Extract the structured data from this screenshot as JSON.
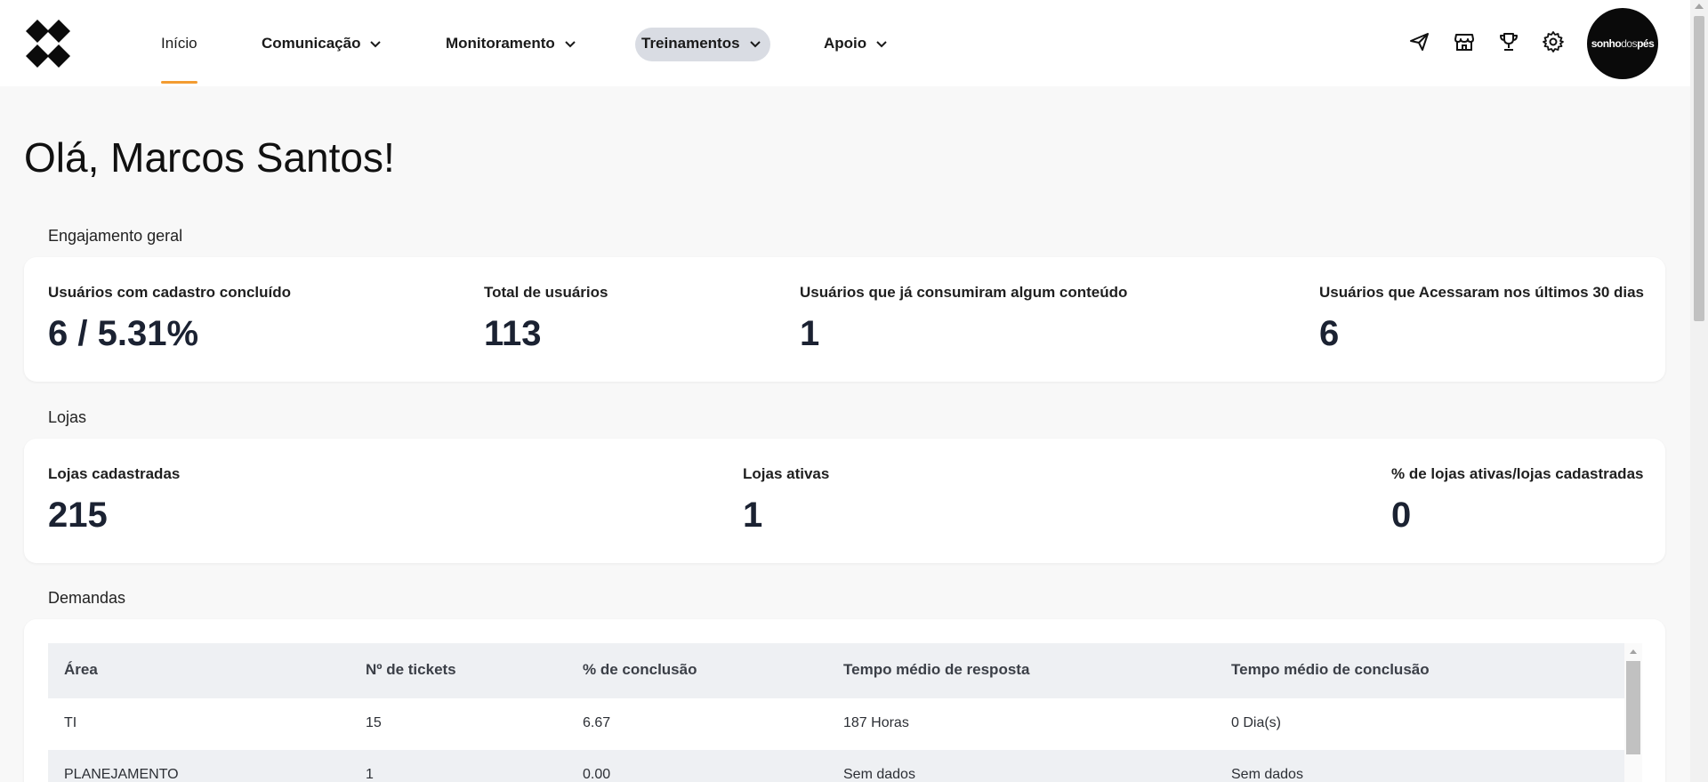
{
  "header": {
    "logo_icon": "diamond-grid-logo",
    "nav": [
      {
        "label": "Início",
        "has_dropdown": false,
        "active": true
      },
      {
        "label": "Comunicação",
        "has_dropdown": true
      },
      {
        "label": "Monitoramento",
        "has_dropdown": true
      },
      {
        "label": "Treinamentos",
        "has_dropdown": true,
        "highlighted": true
      },
      {
        "label": "Apoio",
        "has_dropdown": true
      }
    ],
    "icons": [
      "send-icon",
      "store-icon",
      "trophy-icon",
      "gear-icon"
    ],
    "brand": {
      "part1": "sonho",
      "part2": "dos",
      "part3": "pés"
    }
  },
  "greeting": "Olá, Marcos Santos!",
  "engagement": {
    "title": "Engajamento geral",
    "stats": [
      {
        "label": "Usuários com cadastro concluído",
        "value": "6 / 5.31%"
      },
      {
        "label": "Total de usuários",
        "value": "113"
      },
      {
        "label": "Usuários que já consumiram algum conteúdo",
        "value": "1"
      },
      {
        "label": "Usuários que Acessaram nos últimos 30 dias",
        "value": "6"
      }
    ]
  },
  "stores": {
    "title": "Lojas",
    "stats": [
      {
        "label": "Lojas cadastradas",
        "value": "215"
      },
      {
        "label": "Lojas ativas",
        "value": "1"
      },
      {
        "label": "% de lojas ativas/lojas cadastradas",
        "value": "0"
      }
    ]
  },
  "demands": {
    "title": "Demandas",
    "columns": [
      "Área",
      "Nº de tickets",
      "% de conclusão",
      "Tempo médio de resposta",
      "Tempo médio de conclusão"
    ],
    "rows": [
      [
        "TI",
        "15",
        "6.67",
        "187 Horas",
        "0 Dia(s)"
      ],
      [
        "PLANEJAMENTO",
        "1",
        "0.00",
        "Sem dados",
        "Sem dados"
      ]
    ]
  },
  "colors": {
    "accent": "#f39c32",
    "pill": "#d9dce3",
    "value_text": "#1b2232"
  }
}
